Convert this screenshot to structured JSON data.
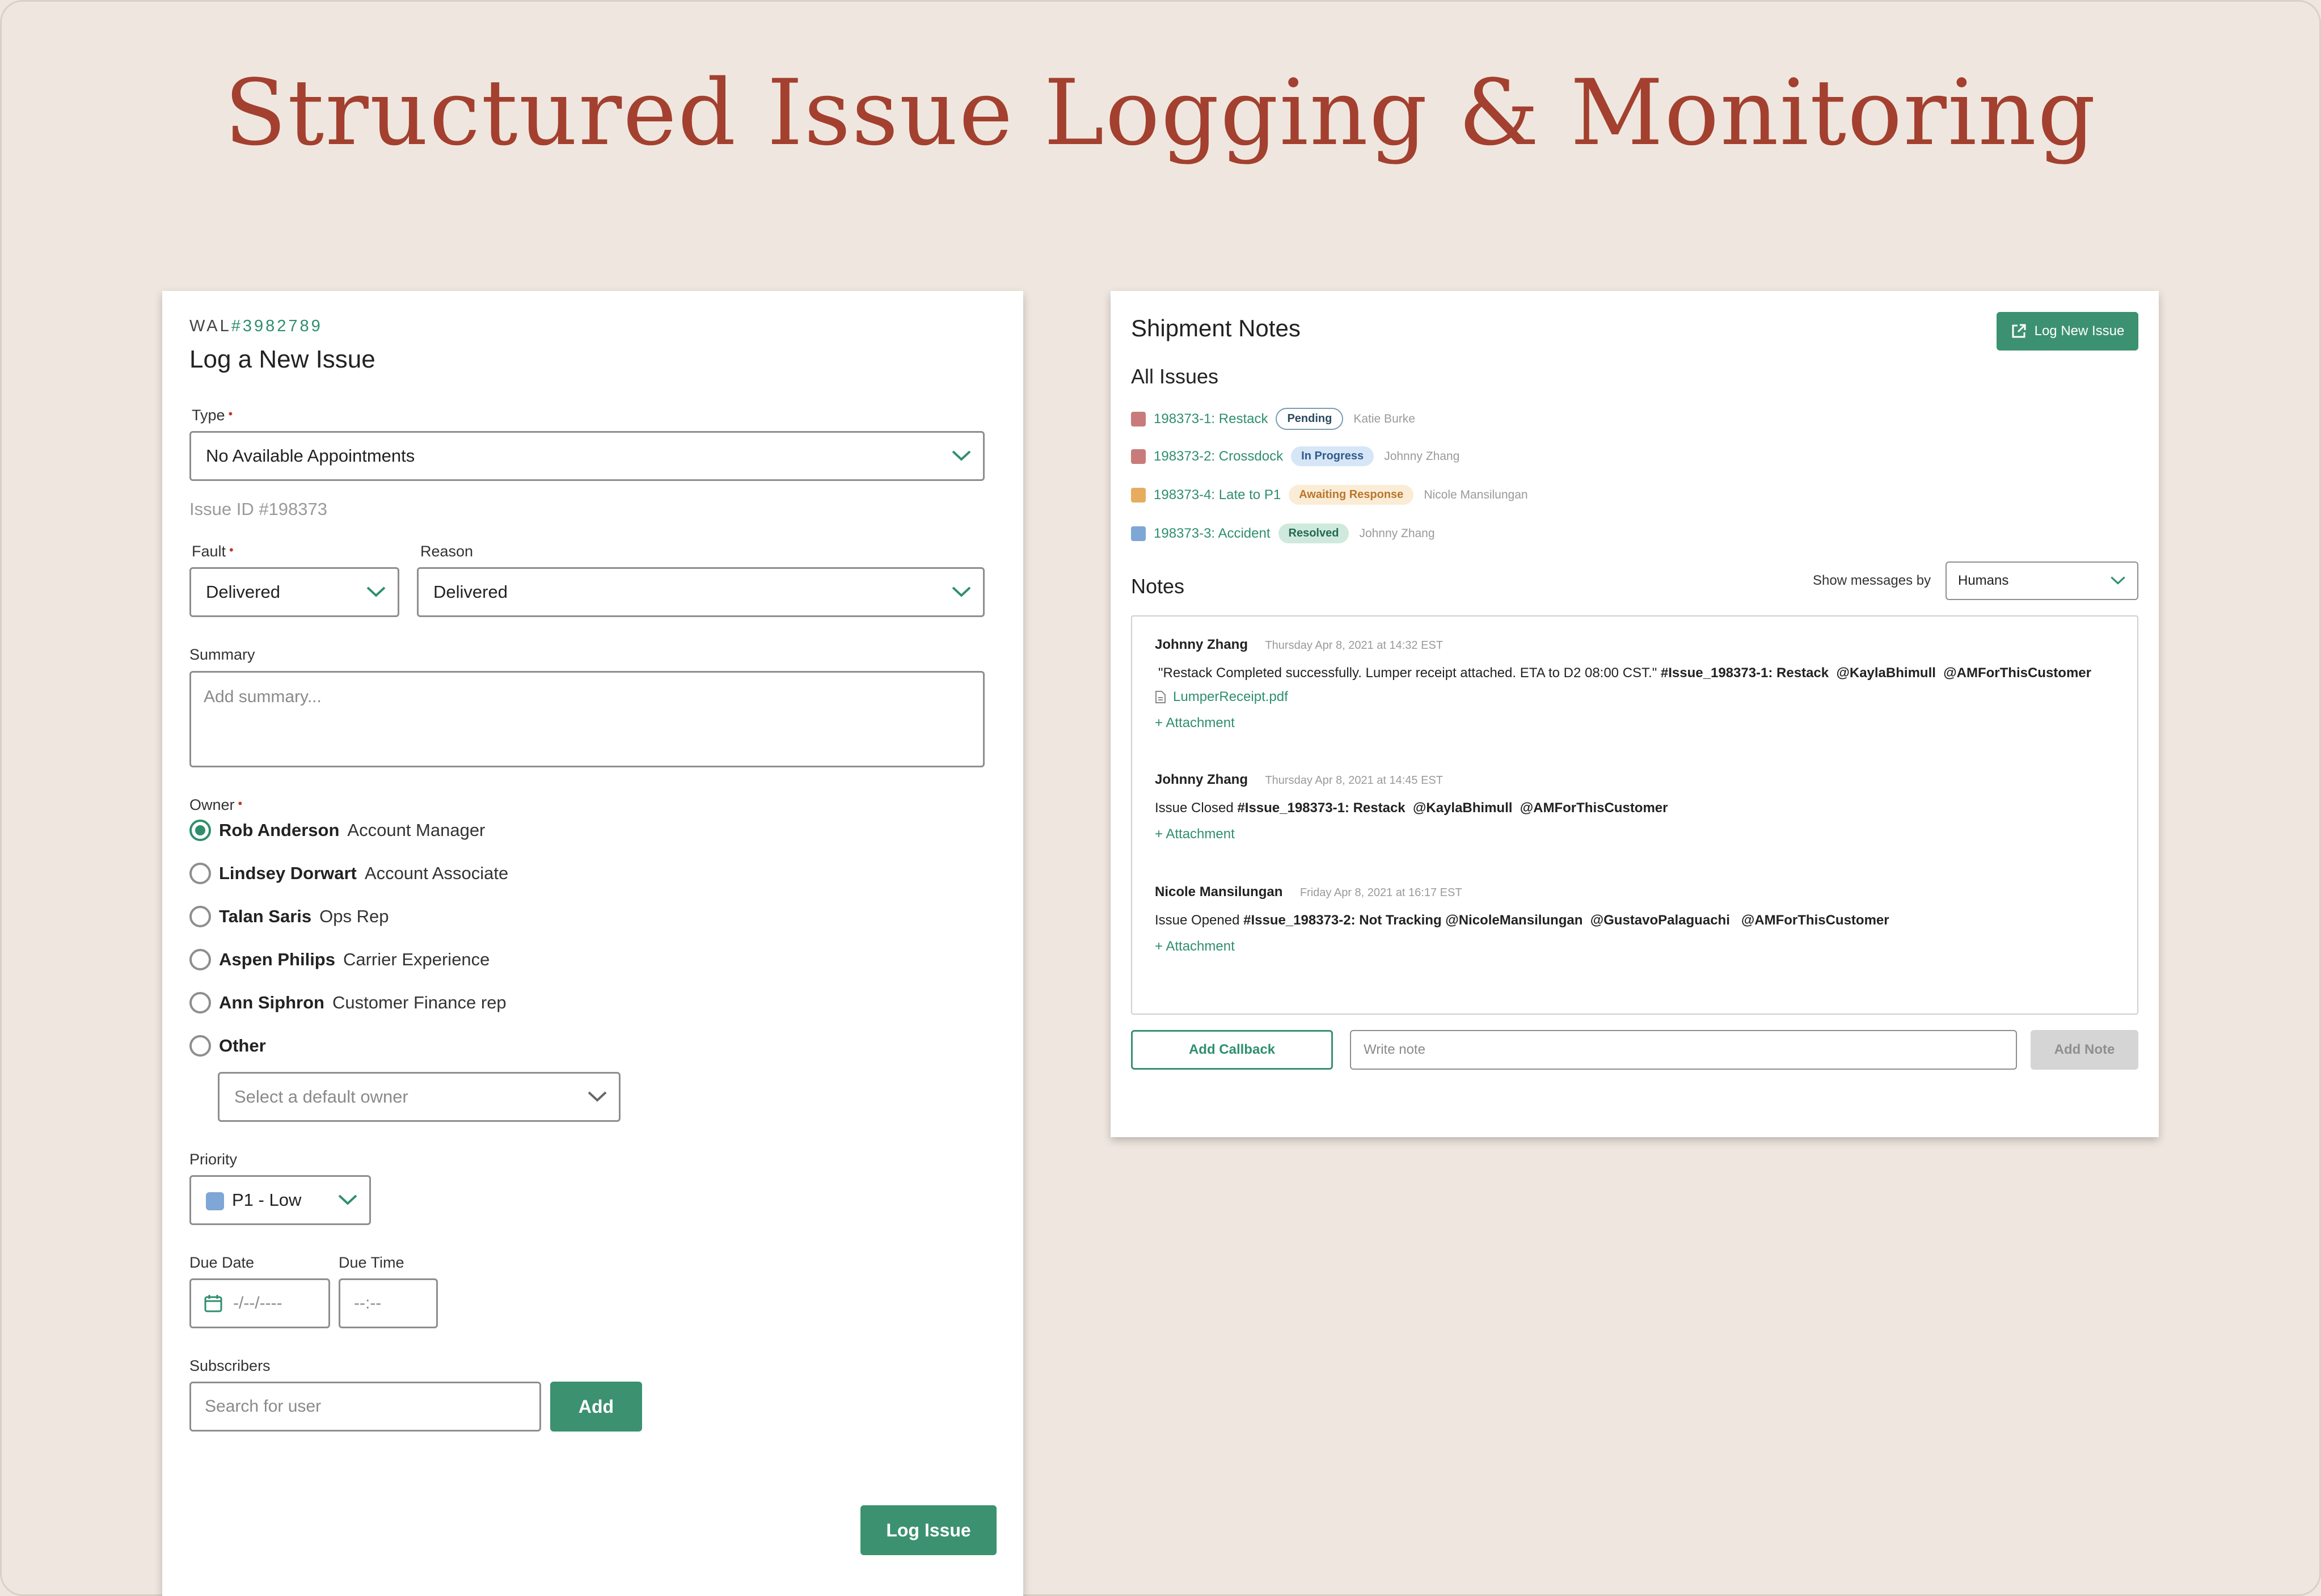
{
  "page_title": "Structured Issue Logging & Monitoring",
  "colors": {
    "accent": "#3c9170",
    "title": "#a3402f",
    "background": "#efe7df"
  },
  "log_form": {
    "shipment_prefix": "WAL",
    "shipment_number": "#3982789",
    "title": "Log a New Issue",
    "type_label": "Type",
    "type_value": "No Available Appointments",
    "issue_id": "Issue ID #198373",
    "fault_label": "Fault",
    "fault_value": "Delivered",
    "reason_label": "Reason",
    "reason_value": "Delivered",
    "summary_label": "Summary",
    "summary_placeholder": "Add summary...",
    "owner_label": "Owner",
    "owners": [
      {
        "name": "Rob Anderson",
        "role": "Account Manager",
        "selected": true
      },
      {
        "name": "Lindsey Dorwart",
        "role": "Account Associate",
        "selected": false
      },
      {
        "name": "Talan Saris",
        "role": "Ops Rep",
        "selected": false
      },
      {
        "name": "Aspen Philips",
        "role": "Carrier Experience",
        "selected": false
      },
      {
        "name": "Ann Siphron",
        "role": "Customer Finance rep",
        "selected": false
      },
      {
        "name": "Other",
        "role": "",
        "selected": false
      }
    ],
    "default_owner_placeholder": "Select a default owner",
    "priority_label": "Priority",
    "priority_value": "P1 - Low",
    "priority_color": "#7ea6d6",
    "due_date_label": "Due Date",
    "due_date_placeholder": "-/--/----",
    "due_time_label": "Due Time",
    "due_time_placeholder": "--:--",
    "subscribers_label": "Subscribers",
    "subscribers_placeholder": "Search for user",
    "add_button": "Add",
    "submit_button": "Log Issue"
  },
  "shipment_notes": {
    "title": "Shipment Notes",
    "log_button": "Log New Issue",
    "all_issues_label": "All Issues",
    "issues": [
      {
        "id": "198373-1: Restack",
        "status": "Pending",
        "owner": "Katie Burke",
        "color": "#c97b7b"
      },
      {
        "id": "198373-2: Crossdock",
        "status": "In Progress",
        "owner": "Johnny Zhang",
        "color": "#c97b7b"
      },
      {
        "id": "198373-4: Late to P1",
        "status": "Awaiting Response",
        "owner": "Nicole Mansilungan",
        "color": "#e6ad5f"
      },
      {
        "id": "198373-3: Accident",
        "status": "Resolved",
        "owner": "Johnny Zhang",
        "color": "#7ea6d6"
      }
    ],
    "notes_label": "Notes",
    "show_by_label": "Show messages by",
    "show_by_value": "Humans",
    "notes": [
      {
        "author": "Johnny Zhang",
        "time": "Thursday Apr 8, 2021 at 14:32 EST",
        "text": "\"Restack Completed successfully.  Lumper receipt attached.  ETA to D2 08:00 CST.\"",
        "tags": "#Issue_198373-1: Restack  @KaylaBhimull  @AMForThisCustomer",
        "file": "LumperReceipt.pdf",
        "attach": "+ Attachment"
      },
      {
        "author": "Johnny Zhang",
        "time": "Thursday Apr 8, 2021 at 14:45 EST",
        "text": "Issue Closed",
        "tags": "#Issue_198373-1: Restack  @KaylaBhimull  @AMForThisCustomer",
        "attach": "+ Attachment"
      },
      {
        "author": "Nicole Mansilungan",
        "time": "Friday Apr 8, 2021 at 16:17 EST",
        "text": "Issue Opened",
        "tags": "#Issue_198373-2: Not Tracking @NicoleMansilungan  @GustavoPalaguachi   @AMForThisCustomer",
        "attach": "+ Attachment"
      }
    ],
    "callback_button": "Add Callback",
    "note_placeholder": "Write note",
    "add_note_button": "Add Note"
  }
}
